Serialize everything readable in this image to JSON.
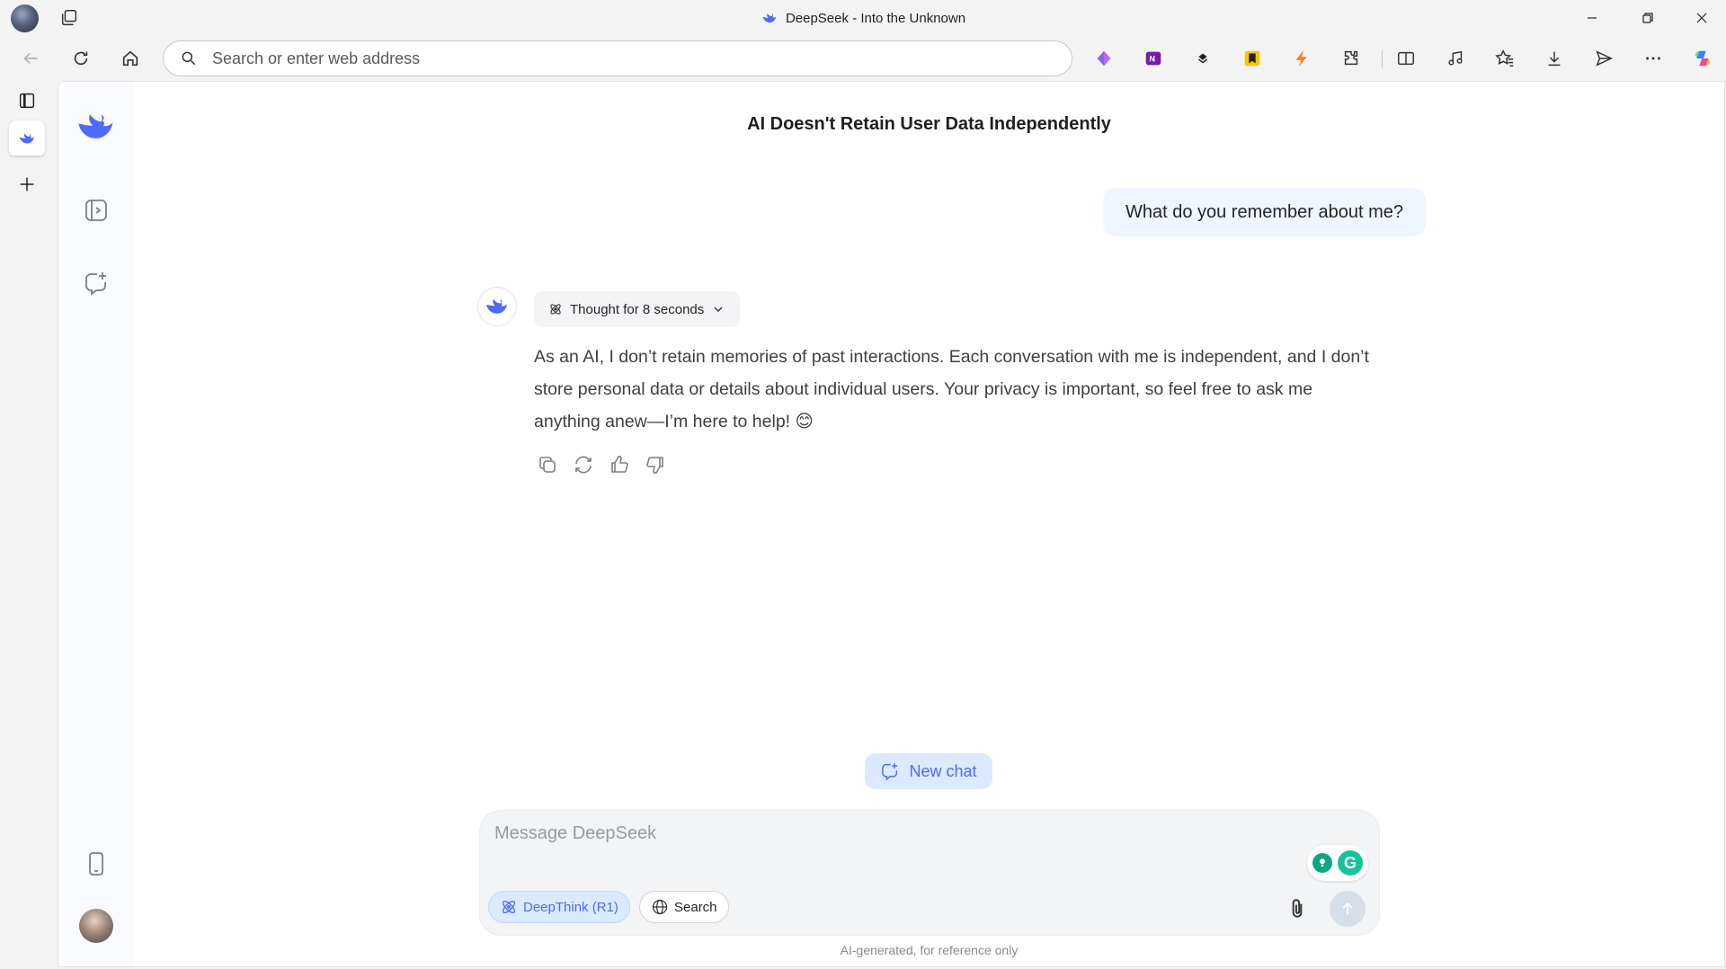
{
  "browser": {
    "window_title": "DeepSeek - Into the Unknown",
    "address_placeholder": "Search or enter web address"
  },
  "sidebar": {
    "items": [
      {
        "icon": "deepseek-logo-icon"
      },
      {
        "icon": "open-sidebar-icon"
      },
      {
        "icon": "new-chat-icon"
      },
      {
        "icon": "mobile-app-icon"
      },
      {
        "icon": "user-avatar"
      }
    ]
  },
  "chat": {
    "title": "AI Doesn't Retain User Data Independently",
    "user_message": "What do you remember about me?",
    "thought_label": "Thought for 8 seconds",
    "answer": "As an AI, I don’t retain memories of past interactions. Each conversation with me is independent, and I don’t store personal data or details about individual users. Your privacy is important, so feel free to ask me anything anew—I’m here to help! 😊",
    "actions": [
      "copy-icon",
      "regenerate-icon",
      "thumbs-up-icon",
      "thumbs-down-icon"
    ]
  },
  "new_chat_label": "New chat",
  "composer": {
    "placeholder": "Message DeepSeek",
    "deepthink_label": "DeepThink (R1)",
    "search_label": "Search"
  },
  "disclaimer": "AI-generated, for reference only",
  "colors": {
    "accent": "#4d6bfe",
    "accent_bg": "#dbeafe",
    "user_bubble": "#eff6ff",
    "grammarly": "#15c39a"
  }
}
